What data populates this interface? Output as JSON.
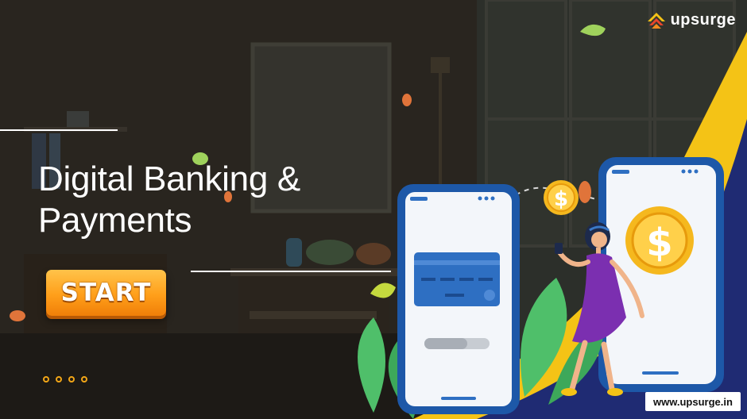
{
  "slide": {
    "title_line1": "Digital Banking &",
    "title_line2": "Payments",
    "start_label": "START"
  },
  "brand": {
    "name": "upsurge",
    "url": "www.upsurge.in",
    "logo_icon": "upsurge-logo-icon"
  },
  "pagination": {
    "dot_count": 4,
    "dot_color": "#f2a617"
  },
  "colors": {
    "accent_yellow": "#f4c316",
    "navy": "#1f2b73",
    "button_orange": "#ff9f1a",
    "phone_blue": "#1d58a8",
    "card_blue": "#2e6fc2",
    "coin_gold": "#f5b81e",
    "dress_purple": "#7b2fb0",
    "leaf_green": "#4fbf6a"
  },
  "icons": [
    "dollar-coin-icon",
    "credit-card-icon",
    "upsurge-logo-icon"
  ]
}
